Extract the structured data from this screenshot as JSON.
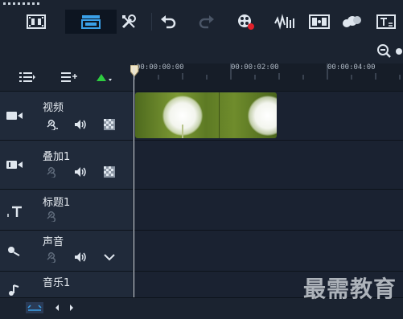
{
  "toolbar": {
    "buttons": [
      {
        "name": "storyboard-view-icon"
      },
      {
        "name": "timeline-view-icon"
      },
      {
        "name": "tools-icon"
      },
      {
        "name": "undo-icon"
      },
      {
        "name": "redo-icon"
      },
      {
        "name": "record-capture-icon"
      },
      {
        "name": "sound-mixer-icon"
      },
      {
        "name": "auto-music-icon"
      },
      {
        "name": "motion-tracking-icon"
      },
      {
        "name": "subtitle-editor-icon"
      }
    ]
  },
  "ruler": {
    "ticks": [
      "00:00:00:00",
      "00:00:02:00",
      "00:00:04:00"
    ]
  },
  "tracks": [
    {
      "label": "视频"
    },
    {
      "label": "叠加1"
    },
    {
      "label": "标题1"
    },
    {
      "label": "声音"
    },
    {
      "label": "音乐1"
    }
  ],
  "watermark": "最需教育",
  "colors": {
    "accent": "#3aa0e8",
    "record": "#e0202a",
    "green_arrow": "#2ecc40"
  }
}
